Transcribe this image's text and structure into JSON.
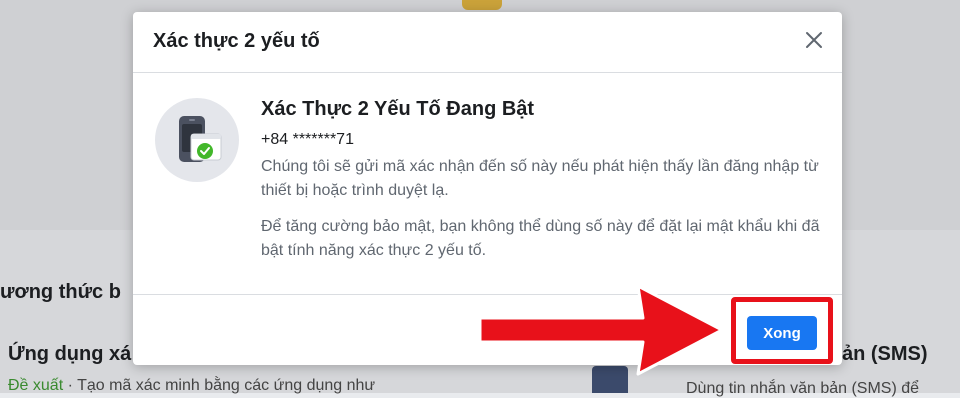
{
  "background": {
    "section_heading": "ương thức b",
    "app_title": "Ứng dụng xá",
    "recommended_label": "Đề xuất",
    "recommended_text": " · Tạo mã xác minh bằng các ứng dụng như",
    "sms_title": "ản (SMS)",
    "sms_desc": "Dùng tin nhắn văn bản (SMS) để"
  },
  "modal": {
    "title": "Xác thực 2 yếu tố",
    "heading": "Xác Thực 2 Yếu Tố Đang Bật",
    "phone": "+84 *******71",
    "para1": "Chúng tôi sẽ gửi mã xác nhận đến số này nếu phát hiện thấy lần đăng nhập từ thiết bị hoặc trình duyệt lạ.",
    "para2": "Để tăng cường bảo mật, bạn không thể dùng số này để đặt lại mật khẩu khi đã bật tính năng xác thực 2 yếu tố.",
    "done_label": "Xong"
  },
  "colors": {
    "primary": "#1877f2",
    "annotation": "#e8111a"
  },
  "icons": {
    "close": "close-icon",
    "device": "phone-check-icon"
  }
}
